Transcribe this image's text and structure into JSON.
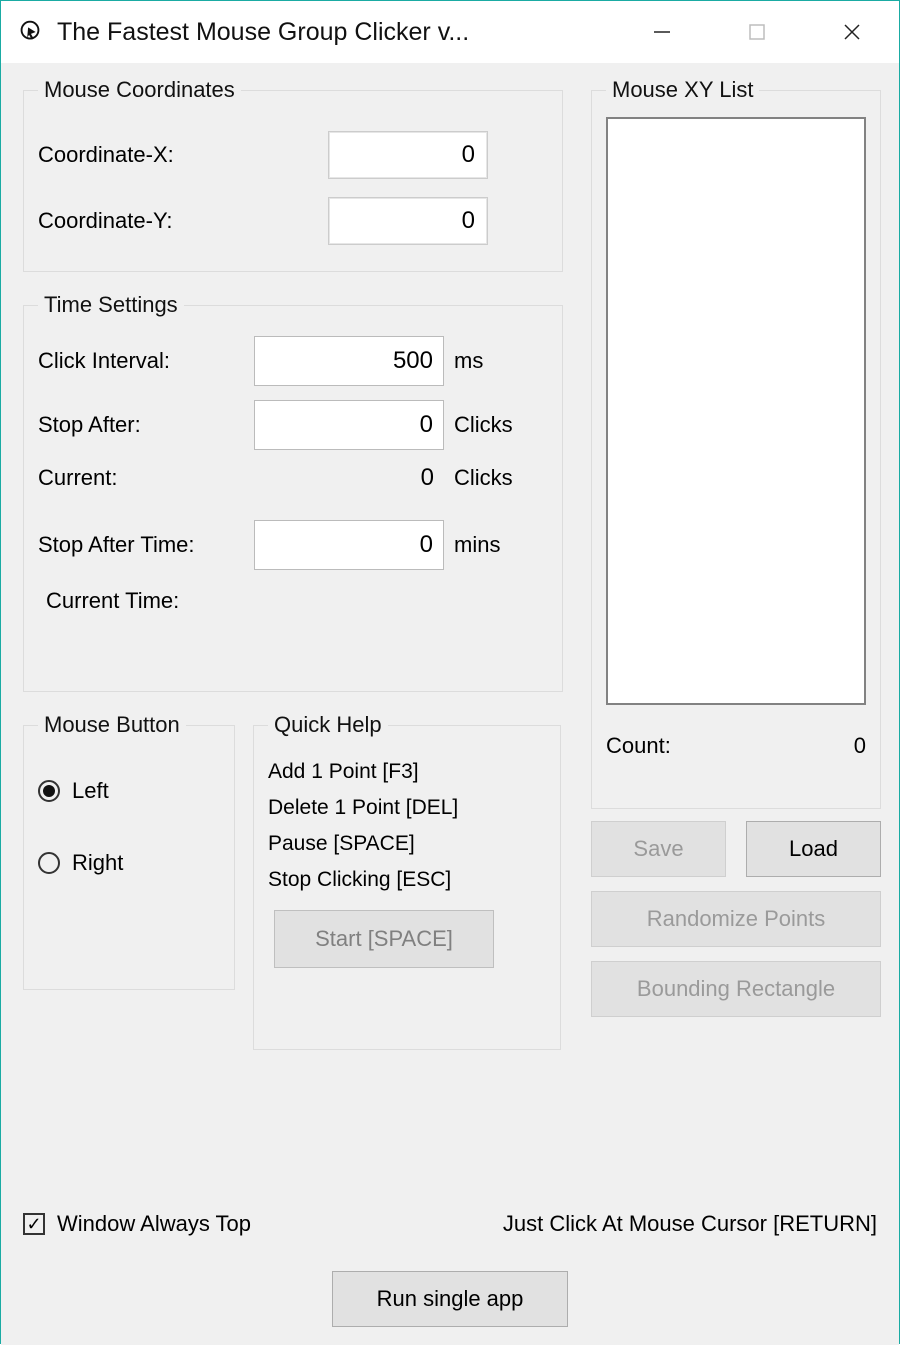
{
  "window": {
    "title": "The Fastest Mouse Group Clicker v..."
  },
  "coords": {
    "legend": "Mouse Coordinates",
    "x_label": "Coordinate-X:",
    "x_value": "0",
    "y_label": "Coordinate-Y:",
    "y_value": "0"
  },
  "time": {
    "legend": "Time Settings",
    "click_interval_label": "Click Interval:",
    "click_interval_value": "500",
    "click_interval_unit": "ms",
    "stop_after_label": "Stop After:",
    "stop_after_value": "0",
    "stop_after_unit": "Clicks",
    "current_label": "Current:",
    "current_value": "0",
    "current_unit": "Clicks",
    "stop_after_time_label": "Stop After Time:",
    "stop_after_time_value": "0",
    "stop_after_time_unit": "mins",
    "current_time_label": "Current Time:"
  },
  "list": {
    "legend": "Mouse XY List",
    "count_label": "Count:",
    "count_value": "0"
  },
  "mouse_button": {
    "legend": "Mouse Button",
    "left": "Left",
    "right": "Right"
  },
  "quick_help": {
    "legend": "Quick Help",
    "add": "Add 1 Point [F3]",
    "del": "Delete 1 Point [DEL]",
    "pause": "Pause [SPACE]",
    "stop": "Stop Clicking [ESC]",
    "start": "Start [SPACE]"
  },
  "buttons": {
    "save": "Save",
    "load": "Load",
    "randomize": "Randomize Points",
    "bounding": "Bounding Rectangle",
    "run_single": "Run single app"
  },
  "bottom": {
    "window_top": "Window Always Top",
    "just_click": "Just Click At Mouse Cursor [RETURN]"
  }
}
